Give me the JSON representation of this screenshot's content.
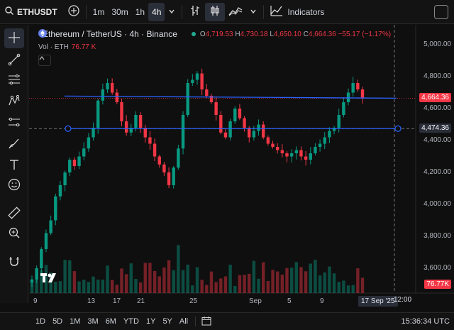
{
  "toolbar": {
    "symbol": "ETHUSDT",
    "timeframes": [
      "1m",
      "30m",
      "1h",
      "4h"
    ],
    "active_timeframe": "4h",
    "indicators_label": "Indicators"
  },
  "legend": {
    "pair": "Ethereum / TetherUS · 4h · Binance",
    "open_key": "O",
    "open": "4,719.53",
    "high_key": "H",
    "high": "4,730.18",
    "low_key": "L",
    "low": "4,650.10",
    "close_key": "C",
    "close": "4,664.36",
    "change": "−55.17 (−1.17%)",
    "vol_label": "Vol · ETH",
    "vol_value": "76.77 K"
  },
  "price_axis": {
    "labels": [
      "5,000.00",
      "4,800.00",
      "4,600.00",
      "4,400.00",
      "4,200.00",
      "4,000.00",
      "3,800.00",
      "3,600.00"
    ],
    "last_price_tag": "4,664.36",
    "crosshair_price_tag": "4,474.36",
    "volume_tag": "76.77K"
  },
  "time_axis": {
    "labels": [
      "9",
      "13",
      "17",
      "21",
      "25",
      "Sep",
      "5",
      "9"
    ],
    "crosshair_date": "17 Sep '25",
    "crosshair_time": "12:00"
  },
  "bottom": {
    "ranges": [
      "1D",
      "5D",
      "1M",
      "3M",
      "6M",
      "YTD",
      "1Y",
      "5Y",
      "All"
    ],
    "clock": "15:36:34 UTC"
  },
  "colors": {
    "up": "#089981",
    "down": "#f23645",
    "line": "#2962ff",
    "background": "#0f0f0f"
  },
  "chart_data": {
    "type": "candlestick",
    "title": "Ethereum / TetherUS · 4h · Binance",
    "ylim": [
      3500,
      5050
    ],
    "horizontal_lines": [
      4665,
      4474.36
    ],
    "close_series": [
      3530,
      3600,
      3720,
      3820,
      3900,
      4050,
      4120,
      4200,
      4280,
      4240,
      4300,
      4350,
      4420,
      4480,
      4650,
      4720,
      4760,
      4700,
      4640,
      4520,
      4450,
      4480,
      4560,
      4480,
      4420,
      4380,
      4300,
      4250,
      4200,
      4120,
      4230,
      4350,
      4560,
      4760,
      4780,
      4820,
      4720,
      4680,
      4640,
      4560,
      4450,
      4420,
      4520,
      4600,
      4540,
      4480,
      4420,
      4460,
      4500,
      4420,
      4380,
      4360,
      4340,
      4320,
      4300,
      4320,
      4340,
      4300,
      4280,
      4320,
      4360,
      4380,
      4420,
      4460,
      4480,
      4560,
      4640,
      4700,
      4760,
      4720,
      4664
    ]
  }
}
